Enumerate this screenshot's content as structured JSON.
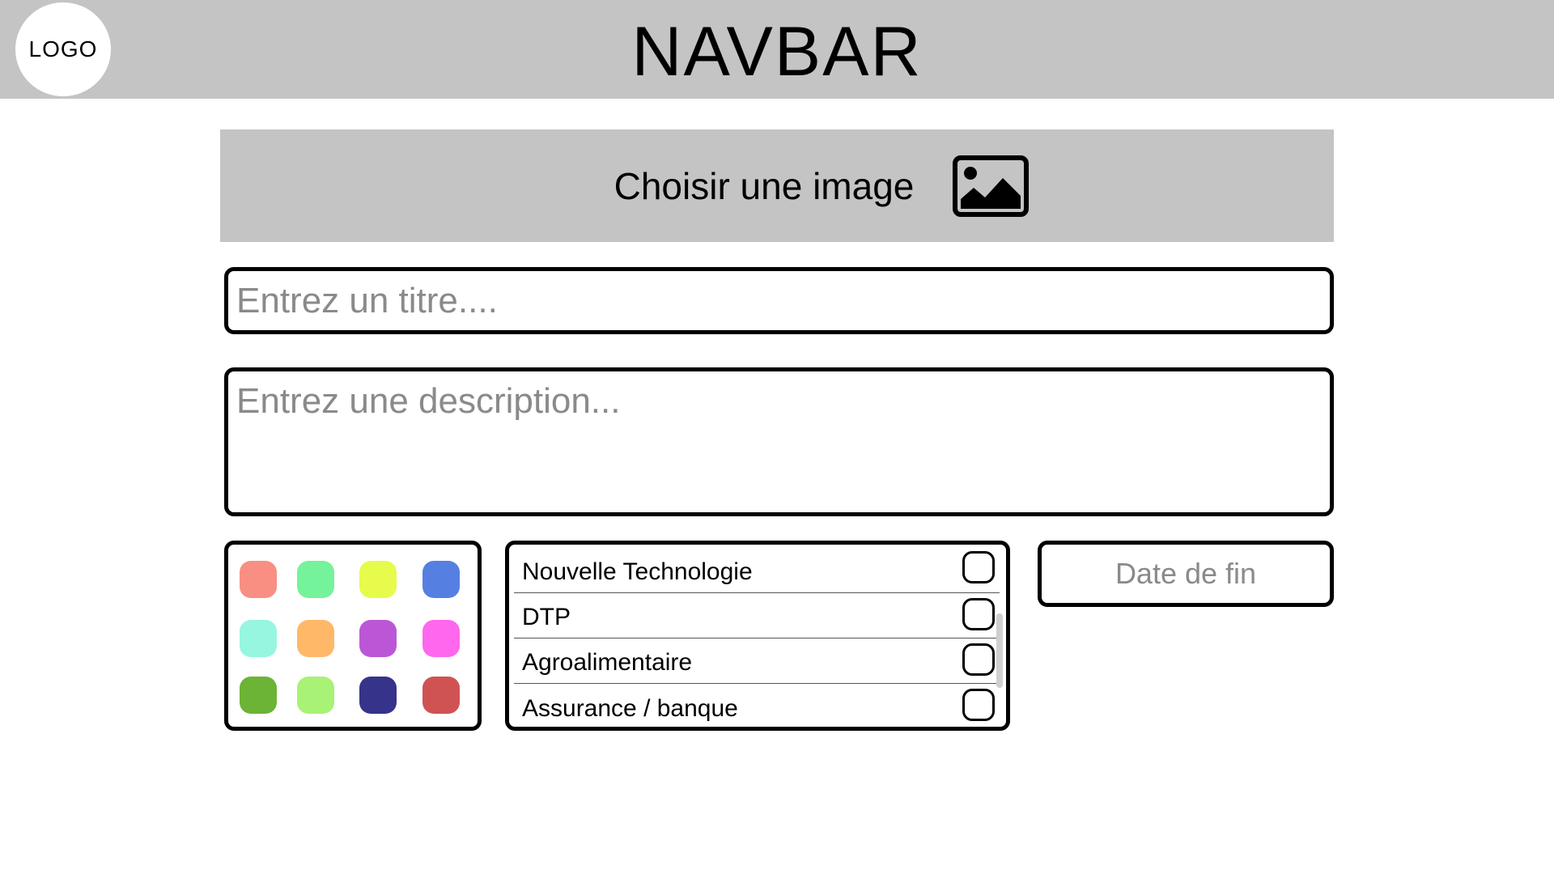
{
  "navbar": {
    "logo_text": "LOGO",
    "title": "NAVBAR"
  },
  "image_picker": {
    "label": "Choisir une image",
    "icon": "image-icon"
  },
  "form": {
    "title_placeholder": "Entrez un titre....",
    "title_value": "",
    "description_placeholder": "Entrez une description...",
    "description_value": "",
    "date_placeholder": "Date de fin",
    "date_value": ""
  },
  "colors": [
    "#f88f82",
    "#74f39b",
    "#e6fb4b",
    "#5580e2",
    "#96f6e0",
    "#ffb868",
    "#bb57d6",
    "#ff67ee",
    "#6bb436",
    "#a8f275",
    "#36348a",
    "#d05353"
  ],
  "categories": [
    {
      "label": "Nouvelle Technologie",
      "checked": false
    },
    {
      "label": "DTP",
      "checked": false
    },
    {
      "label": "Agroalimentaire",
      "checked": false
    },
    {
      "label": "Assurance / banque",
      "checked": false
    }
  ]
}
